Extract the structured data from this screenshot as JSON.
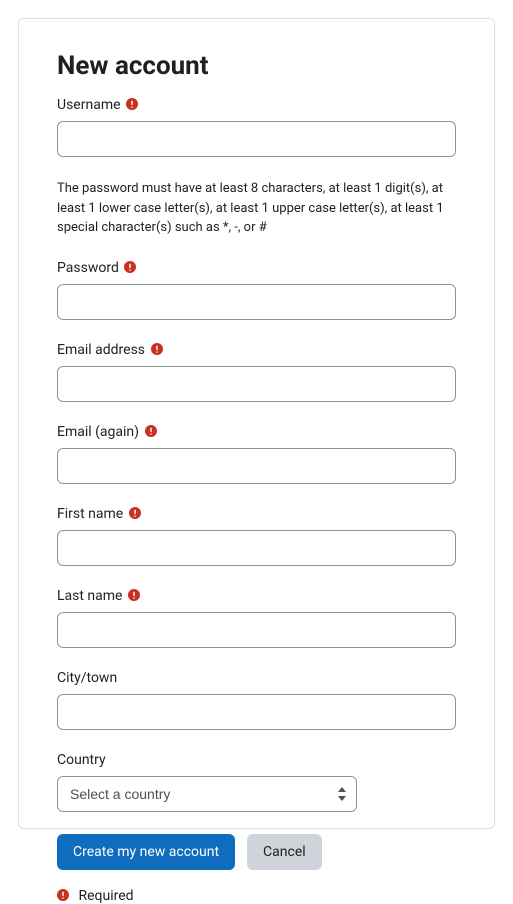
{
  "page": {
    "title": "New account"
  },
  "form": {
    "username": {
      "label": "Username",
      "value": ""
    },
    "password_policy": "The password must have at least 8 characters, at least 1 digit(s), at least 1 lower case letter(s), at least 1 upper case letter(s), at least 1 special character(s) such as *, -, or #",
    "password": {
      "label": "Password",
      "value": ""
    },
    "email": {
      "label": "Email address",
      "value": ""
    },
    "email_again": {
      "label": "Email (again)",
      "value": ""
    },
    "first_name": {
      "label": "First name",
      "value": ""
    },
    "last_name": {
      "label": "Last name",
      "value": ""
    },
    "city": {
      "label": "City/town",
      "value": ""
    },
    "country": {
      "label": "Country",
      "selected": "Select a country"
    }
  },
  "buttons": {
    "submit": "Create my new account",
    "cancel": "Cancel"
  },
  "required_note": "Required"
}
